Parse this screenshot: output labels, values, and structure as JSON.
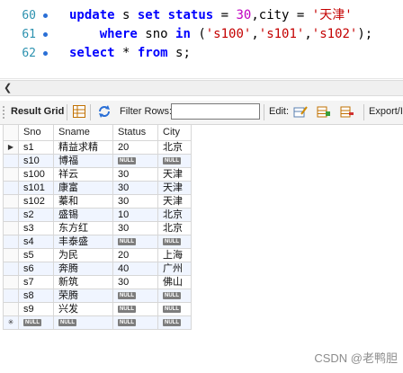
{
  "editor": {
    "lines": [
      {
        "num": "60",
        "parts": [
          [
            "kw",
            "update"
          ],
          [
            "t",
            " s "
          ],
          [
            "kw",
            "set"
          ],
          [
            "t",
            " "
          ],
          [
            "kw",
            "status"
          ],
          [
            "t",
            " = "
          ],
          [
            "num",
            "30"
          ],
          [
            "t",
            ",city = "
          ],
          [
            "str",
            "'天津'"
          ]
        ]
      },
      {
        "num": "61",
        "parts": [
          [
            "t",
            "    "
          ],
          [
            "kw",
            "where"
          ],
          [
            "t",
            " sno "
          ],
          [
            "kw",
            "in"
          ],
          [
            "t",
            " ("
          ],
          [
            "str",
            "'s100'"
          ],
          [
            "t",
            ","
          ],
          [
            "str",
            "'s101'"
          ],
          [
            "t",
            ","
          ],
          [
            "str",
            "'s102'"
          ],
          [
            "t",
            ");"
          ]
        ]
      },
      {
        "num": "62",
        "parts": [
          [
            "kw",
            "select"
          ],
          [
            "t",
            " * "
          ],
          [
            "kw",
            "from"
          ],
          [
            "t",
            " s;"
          ]
        ]
      }
    ]
  },
  "toolbar": {
    "result_grid": "Result Grid",
    "filter_rows": "Filter Rows:",
    "filter_value": "",
    "edit": "Edit:",
    "export": "Export/I"
  },
  "grid": {
    "columns": [
      "Sno",
      "Sname",
      "Status",
      "City"
    ],
    "null_label": "NULL",
    "rows": [
      [
        "s1",
        "精益求精",
        "20",
        "北京"
      ],
      [
        "s10",
        "博福",
        null,
        null
      ],
      [
        "s100",
        "祥云",
        "30",
        "天津"
      ],
      [
        "s101",
        "康富",
        "30",
        "天津"
      ],
      [
        "s102",
        "蓁和",
        "30",
        "天津"
      ],
      [
        "s2",
        "盛锡",
        "10",
        "北京"
      ],
      [
        "s3",
        "东方红",
        "30",
        "北京"
      ],
      [
        "s4",
        "丰泰盛",
        null,
        null
      ],
      [
        "s5",
        "为民",
        "20",
        "上海"
      ],
      [
        "s6",
        "奔腾",
        "40",
        "广州"
      ],
      [
        "s7",
        "新筑",
        "30",
        "佛山"
      ],
      [
        "s8",
        "荣腾",
        null,
        null
      ],
      [
        "s9",
        "兴发",
        null,
        null
      ],
      [
        null,
        null,
        null,
        null
      ]
    ]
  },
  "watermark": "CSDN @老鸭胆"
}
